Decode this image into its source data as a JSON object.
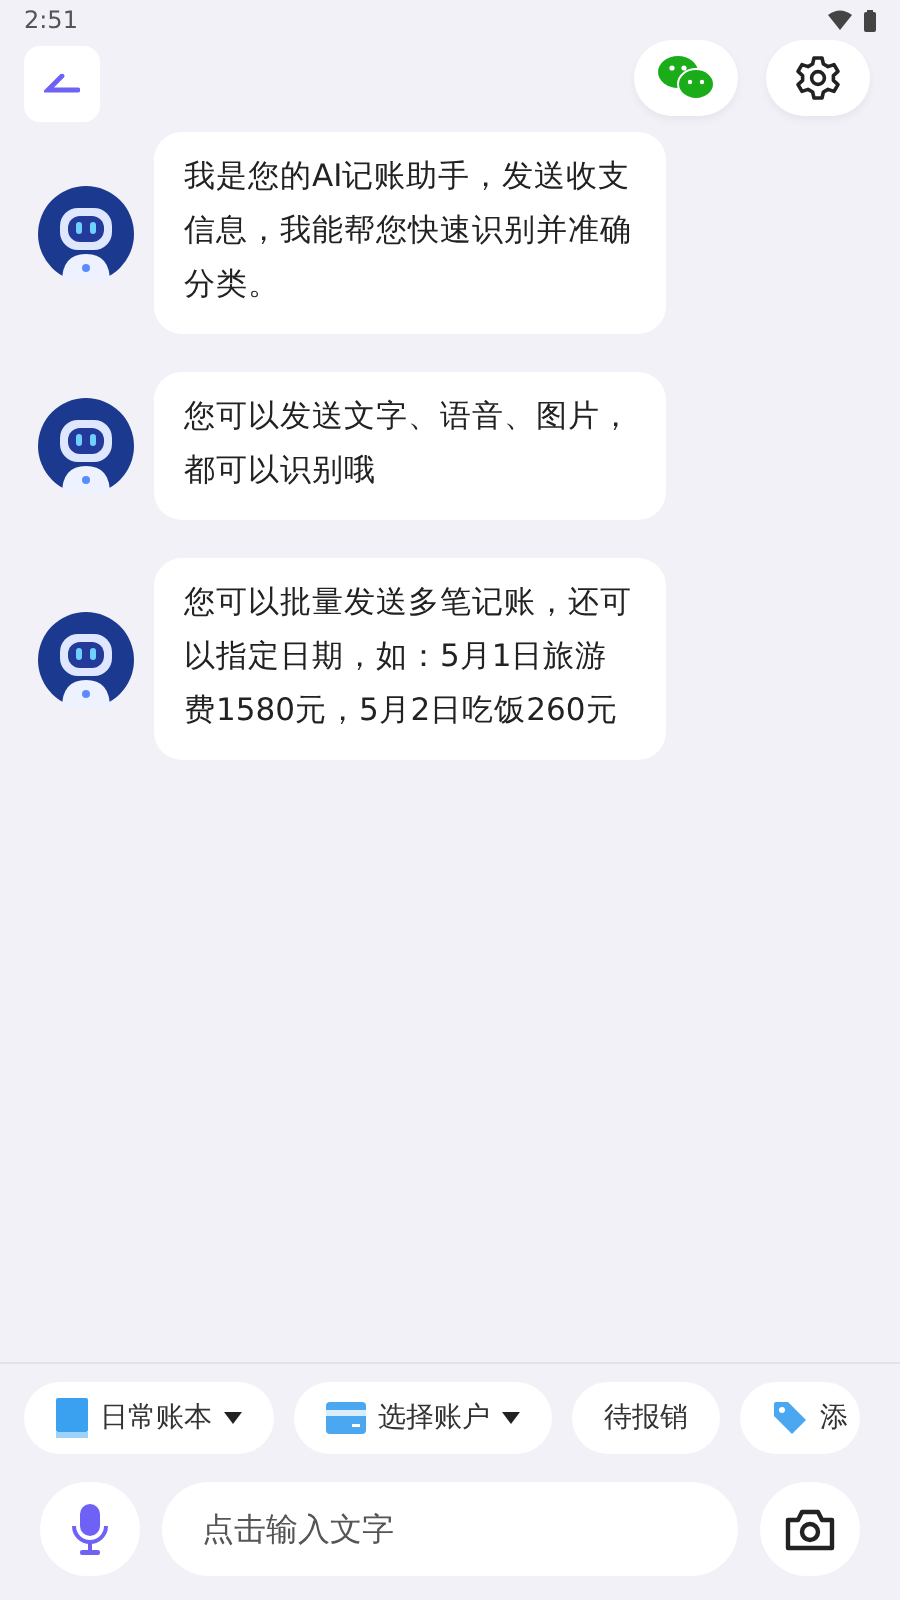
{
  "status_bar": {
    "time": "2:51"
  },
  "messages": [
    {
      "text": "我是您的AI记账助手，发送收支信息，我能帮您快速识别并准确分类。"
    },
    {
      "text": "您可以发送文字、语音、图片，都可以识别哦"
    },
    {
      "text": "您可以批量发送多笔记账，还可以指定日期，如：5月1日旅游费1580元，5月2日吃饭260元"
    }
  ],
  "chips": [
    {
      "kind": "book",
      "label": "日常账本",
      "dropdown": true
    },
    {
      "kind": "card",
      "label": "选择账户",
      "dropdown": true
    },
    {
      "kind": "plain",
      "label": "待报销",
      "dropdown": false
    },
    {
      "kind": "tag",
      "label": "添",
      "dropdown": false
    }
  ],
  "input": {
    "placeholder": "点击输入文字"
  }
}
